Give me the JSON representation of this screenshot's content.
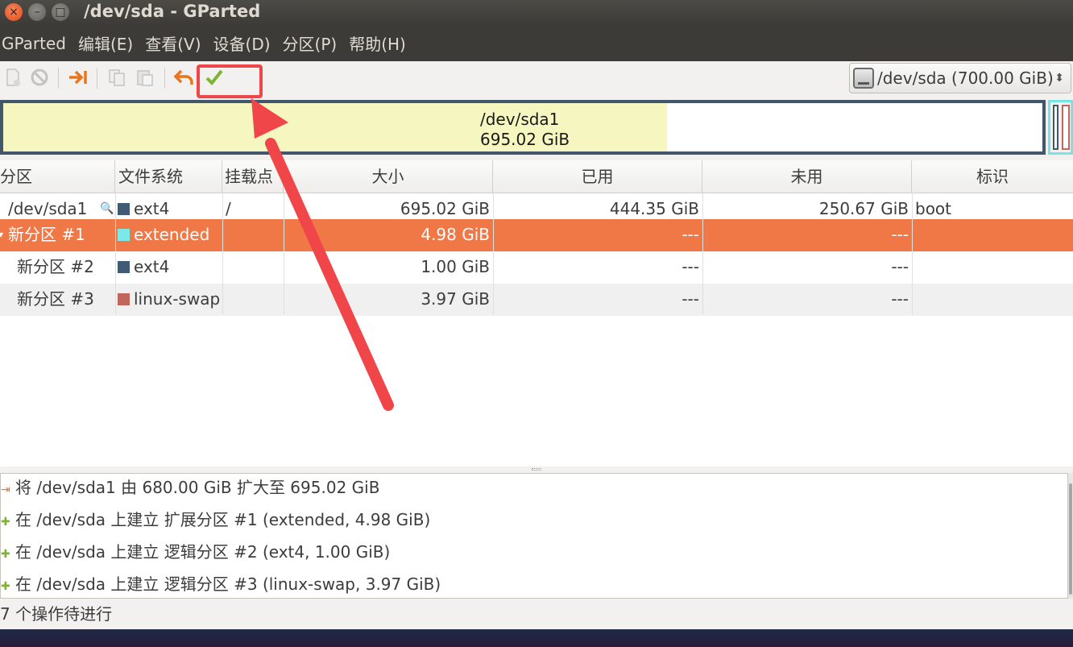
{
  "window": {
    "title": "/dev/sda - GParted",
    "close_glyph": "×",
    "min_glyph": "–",
    "max_glyph": "□"
  },
  "menu": [
    "GParted",
    "编辑(E)",
    "查看(V)",
    "设备(D)",
    "分区(P)",
    "帮助(H)"
  ],
  "toolbar": {
    "icons": [
      "new-partition-icon",
      "delete-icon",
      "resize-move-icon",
      "copy-icon",
      "paste-icon",
      "undo-icon",
      "apply-icon"
    ],
    "device_selector": "/dev/sda  (700.00 GiB)"
  },
  "disk_graph": {
    "partition_name": "/dev/sda1",
    "partition_size": "695.02 GiB",
    "used_fraction_of_sda1": 0.64
  },
  "table": {
    "columns": [
      "分区",
      "文件系统",
      "挂载点",
      "大小",
      "已用",
      "未用",
      "标识"
    ],
    "rows": [
      {
        "partition": "/dev/sda1",
        "filesystem": "ext4",
        "fs_color": "#425b74",
        "mount": "/",
        "size": "695.02 GiB",
        "used": "444.35 GiB",
        "unused": "250.67 GiB",
        "flags": "boot"
      },
      {
        "partition": "新分区 #1",
        "filesystem": "extended",
        "fs_color": "#7de8e8",
        "mount": "",
        "size": "4.98 GiB",
        "used": "---",
        "unused": "---",
        "flags": ""
      },
      {
        "partition": "新分区 #2",
        "filesystem": "ext4",
        "fs_color": "#425b74",
        "mount": "",
        "size": "1.00 GiB",
        "used": "---",
        "unused": "---",
        "flags": ""
      },
      {
        "partition": "新分区 #3",
        "filesystem": "linux-swap",
        "fs_color": "#c1665a",
        "mount": "",
        "size": "3.97 GiB",
        "used": "---",
        "unused": "---",
        "flags": ""
      }
    ]
  },
  "operations": [
    "将 /dev/sda1 由 680.00 GiB 扩大至 695.02 GiB",
    "在 /dev/sda 上建立 扩展分区 #1 (extended, 4.98 GiB)",
    "在 /dev/sda 上建立 逻辑分区 #2 (ext4, 1.00 GiB)",
    "在 /dev/sda 上建立 逻辑分区 #3 (linux-swap, 3.97 GiB)"
  ],
  "status": "7 个操作待进行",
  "colors": {
    "selection": "#f07746",
    "annotation": "#f0464a",
    "titlebar": "#3c3b37"
  }
}
